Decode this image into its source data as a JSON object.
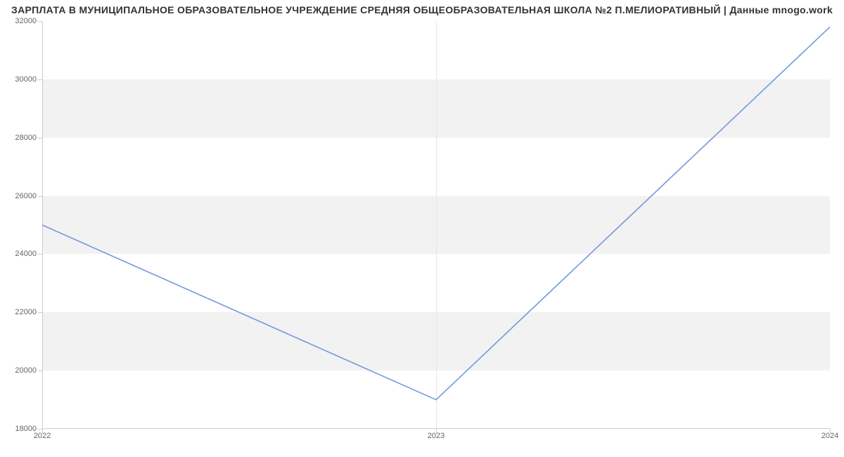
{
  "chart_data": {
    "type": "line",
    "title": "ЗАРПЛАТА В МУНИЦИПАЛЬНОЕ ОБРАЗОВАТЕЛЬНОЕ УЧРЕЖДЕНИЕ СРЕДНЯЯ ОБЩЕОБРАЗОВАТЕЛЬНАЯ ШКОЛА №2 П.МЕЛИОРАТИВНЫЙ | Данные mnogo.work",
    "x": [
      2022,
      2023,
      2024
    ],
    "values": [
      25000,
      19000,
      31800
    ],
    "xlabel": "",
    "ylabel": "",
    "x_ticks": [
      2022,
      2023,
      2024
    ],
    "y_ticks": [
      18000,
      20000,
      22000,
      24000,
      26000,
      28000,
      30000,
      32000
    ],
    "ylim": [
      18000,
      32000
    ],
    "xlim": [
      2022,
      2024
    ],
    "line_color": "#7499dd",
    "band_color": "#f2f2f2"
  }
}
